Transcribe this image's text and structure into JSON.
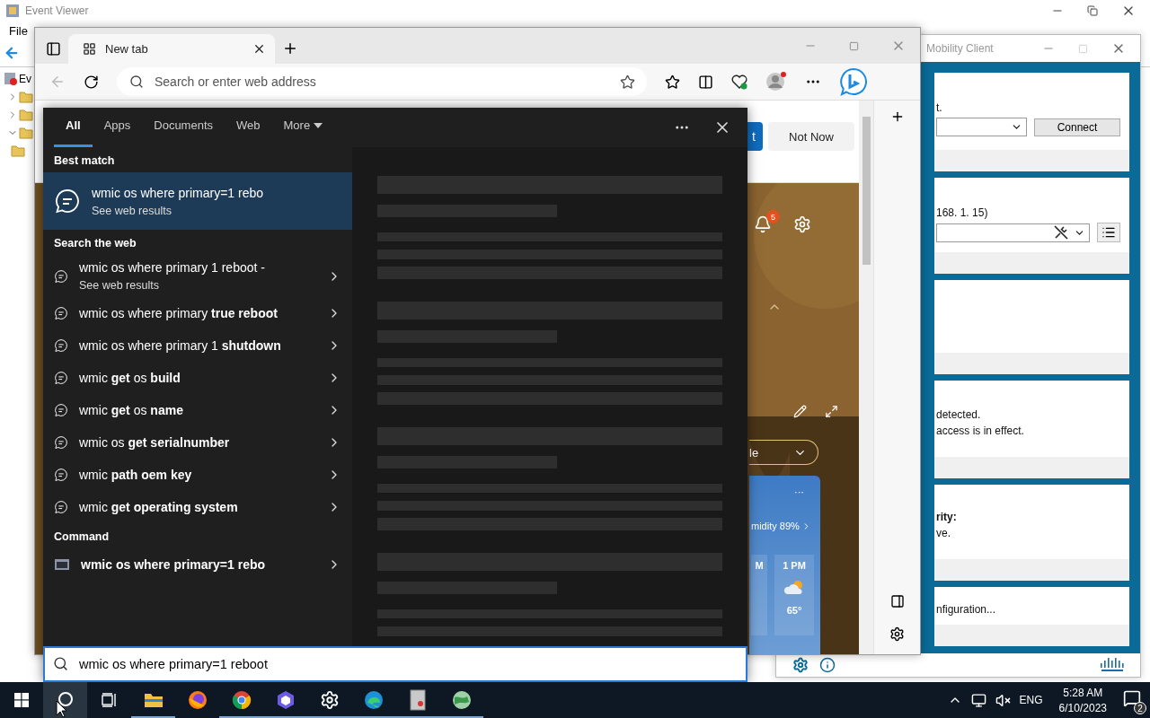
{
  "event_viewer": {
    "title": "Event Viewer",
    "menu": [
      "File"
    ],
    "tree": [
      {
        "label": "Ev",
        "children": [
          {
            "kind": "folder",
            "expanded": false
          },
          {
            "kind": "folder",
            "expanded": false
          },
          {
            "kind": "folder",
            "expanded": true,
            "children": [
              {
                "kind": "folder"
              }
            ]
          }
        ]
      }
    ]
  },
  "cisco": {
    "title": "Mobility Client",
    "connect_button": "Connect",
    "panels": [
      {
        "kind": "connect",
        "lines": [
          {
            "text": "t.",
            "bold": false
          }
        ]
      },
      {
        "kind": "network",
        "lines": [
          {
            "text": "168. 1. 15)",
            "bold": false
          }
        ]
      },
      {
        "kind": "text"
      },
      {
        "kind": "text",
        "lines": [
          {
            "text": "detected.",
            "bold": false
          },
          {
            "text": "access is in effect.",
            "bold": false
          }
        ]
      },
      {
        "kind": "text",
        "lines": [
          {
            "text": "rity:",
            "bold": true
          },
          {
            "text": "ve.",
            "bold": false
          }
        ]
      },
      {
        "kind": "text",
        "lines": [
          {
            "text": "nfiguration...",
            "bold": false
          }
        ]
      }
    ]
  },
  "browser": {
    "tab": {
      "title": "New tab",
      "selected": true
    },
    "address": {
      "placeholder": "Search or enter web address"
    },
    "page": {
      "primary_button": "t",
      "secondary_button": "Not Now",
      "notification_count": "5",
      "location_pill": "le",
      "weather": {
        "more": "···",
        "humidity": "midity 89%",
        "hours": [
          {
            "time": "M"
          },
          {
            "time": "1 PM",
            "temp": "65°"
          }
        ]
      }
    }
  },
  "search": {
    "tabs": [
      {
        "label": "All",
        "selected": true
      },
      {
        "label": "Apps",
        "selected": false
      },
      {
        "label": "Documents",
        "selected": false
      },
      {
        "label": "Web",
        "selected": false
      },
      {
        "label": "More",
        "selected": false
      }
    ],
    "sections": [
      {
        "title": "Best match",
        "items": [
          {
            "kind": "best",
            "title": "wmic os where primary=1 rebo",
            "subtitle": "See web results",
            "selected": true
          }
        ]
      },
      {
        "title": "Search the web",
        "items": [
          {
            "kind": "web",
            "title": "wmic os where primary 1 reboot -",
            "subtitle": "See web results",
            "selected": false
          },
          {
            "kind": "web",
            "title": "wmic os where primary **true reboot**",
            "selected": false
          },
          {
            "kind": "web",
            "title": "wmic os where primary 1 **shutdown**",
            "selected": false
          },
          {
            "kind": "web",
            "title": "wmic **get** os **build**",
            "selected": false
          },
          {
            "kind": "web",
            "title": "wmic **get** os **name**",
            "selected": false
          },
          {
            "kind": "web",
            "title": "wmic os **get serialnumber**",
            "selected": false
          },
          {
            "kind": "web",
            "title": "wmic **path oem key**",
            "selected": false
          },
          {
            "kind": "web",
            "title": "wmic **get operating system**",
            "selected": false
          }
        ]
      },
      {
        "title": "Command",
        "items": [
          {
            "kind": "command",
            "title": "**wmic os where primary=1 rebo**",
            "selected": false
          }
        ]
      }
    ],
    "query": "wmic os where primary=1 reboot"
  },
  "taskbar": {
    "search_active": true,
    "apps": [
      {
        "kind": "folder",
        "running": true
      },
      {
        "kind": "fox",
        "running": false
      },
      {
        "kind": "ring",
        "running": true
      },
      {
        "kind": "hexagon",
        "running": true
      },
      {
        "kind": "gear",
        "running": true
      },
      {
        "kind": "wave",
        "running": true
      },
      {
        "kind": "document",
        "running": true
      },
      {
        "kind": "globe",
        "running": true
      }
    ],
    "language": "ENG",
    "time": "5:28 AM",
    "date": "6/10/2023",
    "notifications": "2"
  }
}
